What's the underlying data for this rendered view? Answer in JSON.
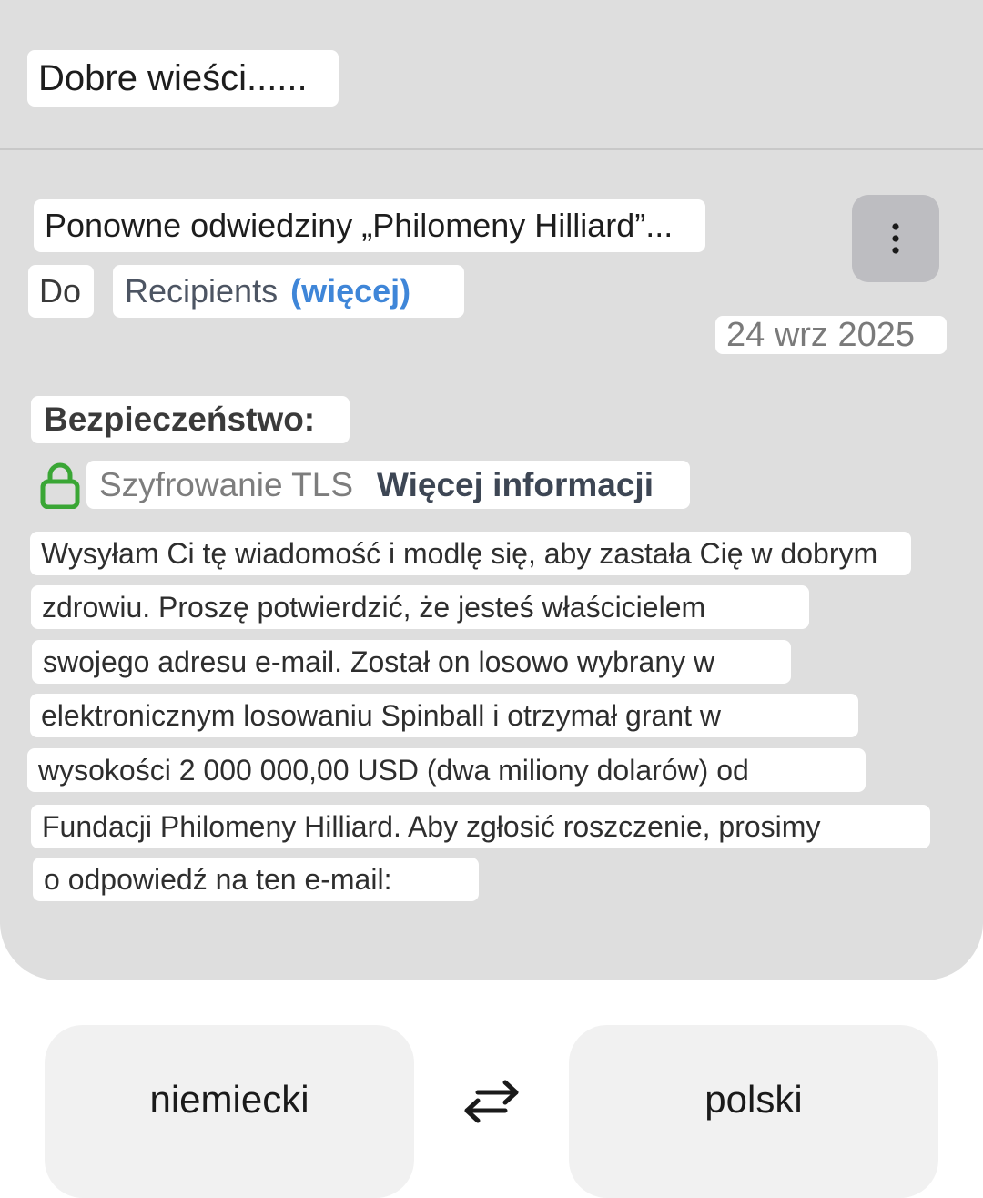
{
  "email": {
    "preview_subject": "Dobre wieści......",
    "subject": "Ponowne odwiedziny „Philomeny Hilliard”...",
    "to_label": "Do",
    "recipients_label": "Recipients",
    "recipients_more": "(więcej)",
    "date": "24 wrz 2025",
    "security": {
      "label": "Bezpieczeństwo:",
      "encryption": "Szyfrowanie TLS",
      "more_info": "Więcej informacji",
      "lock_color": "#3aa635"
    },
    "body_lines": [
      "Wysyłam Ci tę wiadomość i modlę się, aby zastała Cię w dobrym",
      "zdrowiu. Proszę potwierdzić, że jesteś właścicielem",
      "swojego adresu e-mail. Został on losowo wybrany w",
      "elektronicznym losowaniu Spinball i otrzymał grant w",
      "wysokości 2 000 000,00 USD (dwa miliony dolarów) od",
      "Fundacji Philomeny Hilliard. Aby zgłosić roszczenie, prosimy",
      "o odpowiedź na ten e-mail:"
    ]
  },
  "translate_bar": {
    "source_language": "niemiecki",
    "target_language": "polski",
    "swap_icon": "swap-arrows-icon"
  },
  "icons": {
    "overflow": "more-vert-icon",
    "lock": "lock-icon"
  }
}
